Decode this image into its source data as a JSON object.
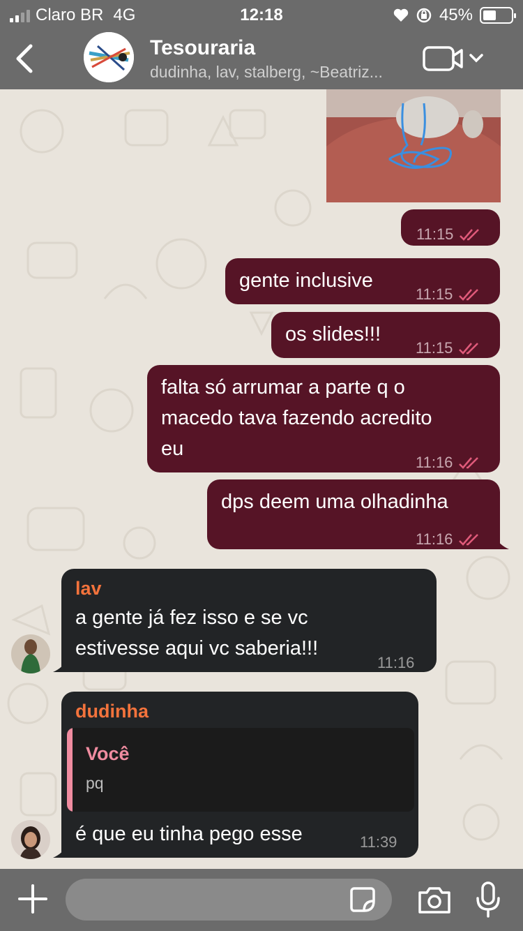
{
  "status": {
    "carrier": "Claro BR",
    "network": "4G",
    "time": "12:18",
    "battery": "45%",
    "battery_level": 0.45
  },
  "header": {
    "title": "Tesouraria",
    "subtitle": "dudinha, lav, stalberg, ~Beatriz..."
  },
  "messages": {
    "img_time": "11:15",
    "m1_text": "gente inclusive",
    "m1_time": "11:15",
    "m2_text": "os slides!!!",
    "m2_time": "11:15",
    "m3_line1": "falta só arrumar a parte q o",
    "m3_line2": "macedo tava fazendo acredito",
    "m3_line3": "eu",
    "m3_time": "11:16",
    "m4_text": "dps deem uma olhadinha",
    "m4_time": "11:16",
    "lav_sender": "lav",
    "lav_line1": "a gente já fez isso e se vc",
    "lav_line2": "estivesse aqui vc saberia!!!",
    "lav_time": "11:16",
    "dud_sender": "dudinha",
    "quote_name": "Você",
    "quote_text": "pq",
    "dud_text": "é que eu tinha pego esse",
    "dud_time": "11:39"
  },
  "colors": {
    "outgoing": "#561426",
    "incoming": "#222426",
    "sender_name": "#f3733c",
    "quote_accent": "#f08ca0",
    "read_ticks": "#e05a7a"
  },
  "icons": [
    "signal-icon",
    "heart-icon",
    "rotation-lock-icon",
    "battery-icon",
    "back-chevron-icon",
    "video-call-icon",
    "chevron-down-icon",
    "double-check-icon",
    "plus-icon",
    "sticker-icon",
    "camera-icon",
    "mic-icon"
  ]
}
